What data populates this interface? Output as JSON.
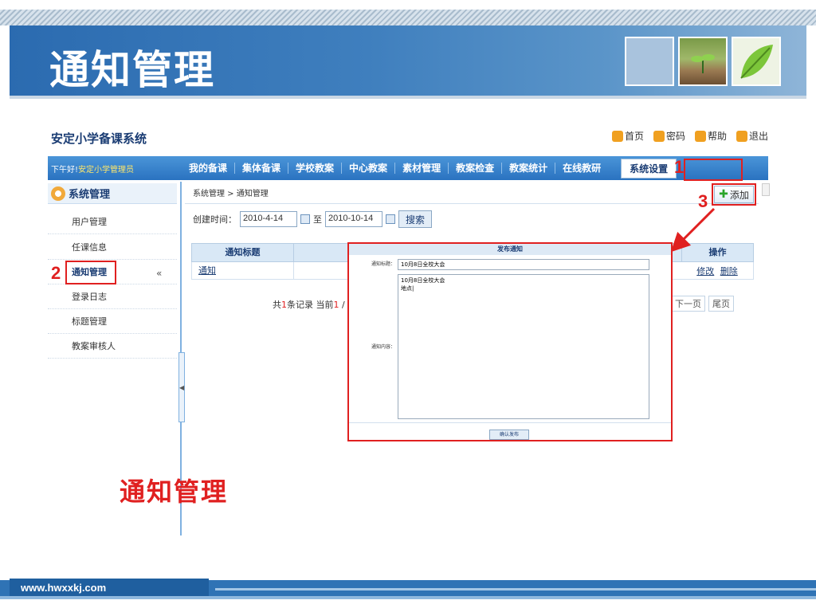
{
  "slide": {
    "title": "通知管理",
    "footer_url": "www.hwxxkj.com",
    "watermark": "通知管理"
  },
  "app": {
    "title": "安定小学备课系统",
    "top_links": [
      {
        "label": "首页",
        "icon": "home-icon",
        "color": "#f0a020"
      },
      {
        "label": "密码",
        "icon": "key-icon",
        "color": "#f0a020"
      },
      {
        "label": "帮助",
        "icon": "help-icon",
        "color": "#f0a020"
      },
      {
        "label": "退出",
        "icon": "exit-icon",
        "color": "#f0a020"
      }
    ],
    "greeting_prefix": "下午好!",
    "greeting_user": "安定小学管理员",
    "nav": [
      "我的备课",
      "集体备课",
      "学校教案",
      "中心教案",
      "素材管理",
      "教案检查",
      "教案统计",
      "在线教研"
    ],
    "nav_active": "系统设置"
  },
  "sidebar": {
    "heading": "系统管理",
    "items": [
      "用户管理",
      "任课信息",
      "通知管理",
      "登录日志",
      "标题管理",
      "教案审核人"
    ],
    "collapse": "«"
  },
  "main": {
    "breadcrumb": "系统管理 > 通知管理",
    "add_label": "添加",
    "search": {
      "label": "创建时间：",
      "from": "2010-4-14",
      "to_label": "至",
      "to": "2010-10-14",
      "button": "搜索"
    },
    "table": {
      "col_title": "通知标题",
      "col_ops": "操作",
      "rows": [
        {
          "title": "通知",
          "edit": "修改",
          "delete": "删除"
        }
      ]
    },
    "pager": {
      "text_a": "共",
      "count": "1",
      "text_b": "条记录 当前",
      "page": "1",
      "text_c": " /",
      "next": "下一页",
      "last": "尾页"
    }
  },
  "dialog": {
    "header": "发布通知",
    "title_label": "通知标题：",
    "title_value": "10月8日全校大会",
    "content_label": "通知内容：",
    "content_line1": "10月8日全校大会",
    "content_line2": "地点|",
    "submit": "确认发布"
  },
  "annotations": {
    "n1": "1",
    "n2": "2",
    "n3": "3"
  }
}
